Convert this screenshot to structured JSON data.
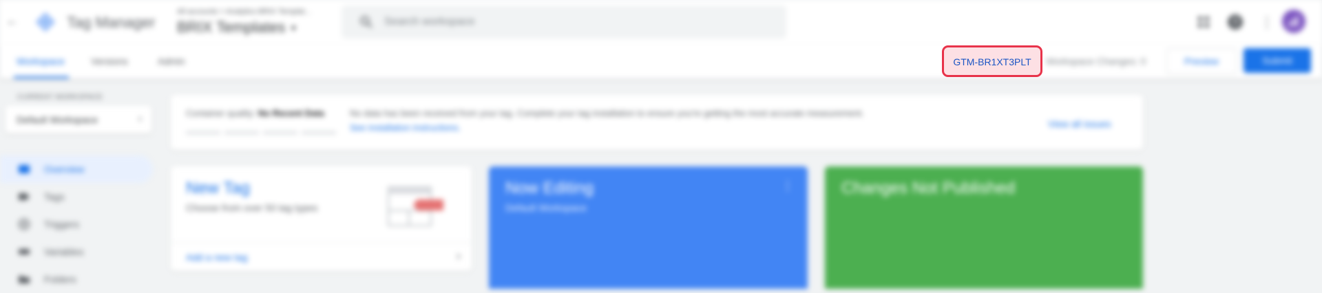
{
  "topbar": {
    "product_name": "Tag Manager",
    "breadcrumb": "All accounts > Analytics BRIX Templat...",
    "container_name": "BRIX Templates",
    "search_placeholder": "Search workspace"
  },
  "subbar": {
    "tabs": [
      {
        "label": "Workspace",
        "active": true
      },
      {
        "label": "Versions",
        "active": false
      },
      {
        "label": "Admin",
        "active": false
      }
    ],
    "container_id": "GTM-BR1XT3PLT",
    "workspace_changes": "Workspace Changes: 0",
    "preview_label": "Preview",
    "submit_label": "Submit"
  },
  "sidebar": {
    "current_workspace_label": "CURRENT WORKSPACE",
    "workspace_name": "Default Workspace",
    "items": [
      {
        "label": "Overview",
        "icon": "overview-icon",
        "active": true
      },
      {
        "label": "Tags",
        "icon": "tag-icon",
        "active": false
      },
      {
        "label": "Triggers",
        "icon": "trigger-icon",
        "active": false
      },
      {
        "label": "Variables",
        "icon": "variable-icon",
        "active": false
      },
      {
        "label": "Folders",
        "icon": "folder-icon",
        "active": false
      }
    ]
  },
  "quality": {
    "label": "Container quality:",
    "value": "No Recent Data",
    "message": "No data has been received from your tag. Complete your tag installation to ensure you're getting the most accurate measurement.",
    "link": "See installation instructions.",
    "view_all": "View all issues"
  },
  "cards": {
    "new_tag": {
      "title": "New Tag",
      "subtitle": "Choose from over 50 tag types",
      "action": "Add a new tag"
    },
    "now_editing": {
      "title": "Now Editing",
      "subtitle": "Default Workspace"
    },
    "changes": {
      "title": "Changes Not Published"
    }
  },
  "colors": {
    "accent": "#1a73e8",
    "editing_card": "#4285f4",
    "changes_card": "#4caf50",
    "highlight_border": "#e8334a",
    "highlight_fill": "#fde0e4"
  }
}
